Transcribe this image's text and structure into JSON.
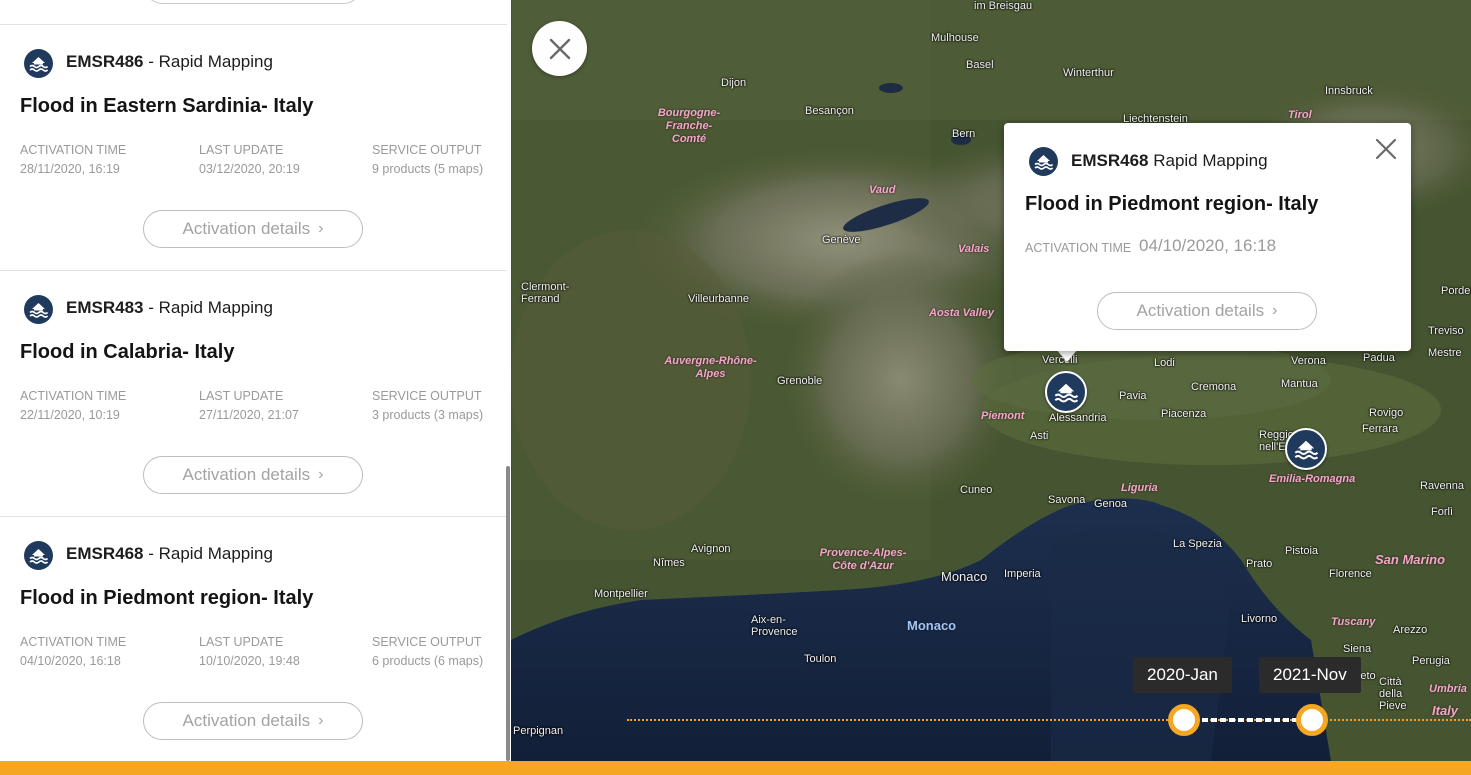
{
  "activations": [
    {
      "code": "EMSR486",
      "service": " - Rapid Mapping",
      "title": "Flood in Eastern Sardinia- Italy",
      "labels": {
        "activation_time": "ACTIVATION TIME",
        "last_update": "LAST UPDATE",
        "service_output": "SERVICE OUTPUT"
      },
      "activation_time": "28/11/2020, 16:19",
      "last_update": "03/12/2020, 20:19",
      "service_output": "9 products (5 maps)",
      "details_label": "Activation details",
      "icon": "flood-icon"
    },
    {
      "code": "EMSR483",
      "service": " - Rapid Mapping",
      "title": "Flood in Calabria- Italy",
      "labels": {
        "activation_time": "ACTIVATION TIME",
        "last_update": "LAST UPDATE",
        "service_output": "SERVICE OUTPUT"
      },
      "activation_time": "22/11/2020, 10:19",
      "last_update": "27/11/2020, 21:07",
      "service_output": "3 products (3 maps)",
      "details_label": "Activation details",
      "icon": "flood-icon"
    },
    {
      "code": "EMSR468",
      "service": " - Rapid Mapping",
      "title": "Flood in Piedmont region- Italy",
      "labels": {
        "activation_time": "ACTIVATION TIME",
        "last_update": "LAST UPDATE",
        "service_output": "SERVICE OUTPUT"
      },
      "activation_time": "04/10/2020, 16:18",
      "last_update": "10/10/2020, 19:48",
      "service_output": "6 products (6 maps)",
      "details_label": "Activation details",
      "icon": "flood-icon"
    }
  ],
  "popup": {
    "code": "EMSR468",
    "service": " Rapid Mapping",
    "title": "Flood in Piedmont region- Italy",
    "activation_time_label": "ACTIVATION TIME",
    "activation_time": "04/10/2020, 16:18",
    "details_label": "Activation details",
    "icon": "flood-icon"
  },
  "timeline": {
    "start_label": "2020-Jan",
    "end_label": "2021-Nov"
  },
  "map": {
    "places": [
      "im Breisgau",
      "Mulhouse",
      "Basel",
      "Winterthur",
      "Innsbruck",
      "Dijon",
      "Besançon",
      "Liechtenstein",
      "Bern",
      "Genève",
      "Clermont-Ferrand",
      "Villeurbanne",
      "Grenoble",
      "Vercelli",
      "Lodi",
      "Verona",
      "Padua",
      "Treviso",
      "Mestre",
      "Pavia",
      "Cremona",
      "Mantua",
      "Alessandria",
      "Piacenza",
      "Asti",
      "Reggio nell'Emilia",
      "Rovigo",
      "Ferrara",
      "Cuneo",
      "Savona",
      "Genoa",
      "Ravenna",
      "Forlì",
      "La Spezia",
      "Pistoia",
      "Florence",
      "Prato",
      "Nîmes",
      "Avignon",
      "Monaco",
      "Imperia",
      "Montpellier",
      "Aix-en-Provence",
      "Toulon",
      "Livorno",
      "Siena",
      "Arezzo",
      "Perugia",
      "Grosseto",
      "Città della Pieve",
      "Perpignan",
      "Pordenone"
    ],
    "regions": [
      "Bourgogne-Franche-Comté",
      "Vaud",
      "Valais",
      "Aosta Valley",
      "Auvergne-Rhône-Alpes",
      "Piemont",
      "Liguria",
      "Emilia-Romagna",
      "Provence-Alpes-Côte d'Azur",
      "Tuscany",
      "Umbria",
      "Italy",
      "San Marino",
      "Tirol"
    ],
    "sea": "Monaco"
  },
  "colors": {
    "accent": "#f5a623",
    "marker": "#1f3a5c",
    "muted_text": "#9a9a9a"
  }
}
